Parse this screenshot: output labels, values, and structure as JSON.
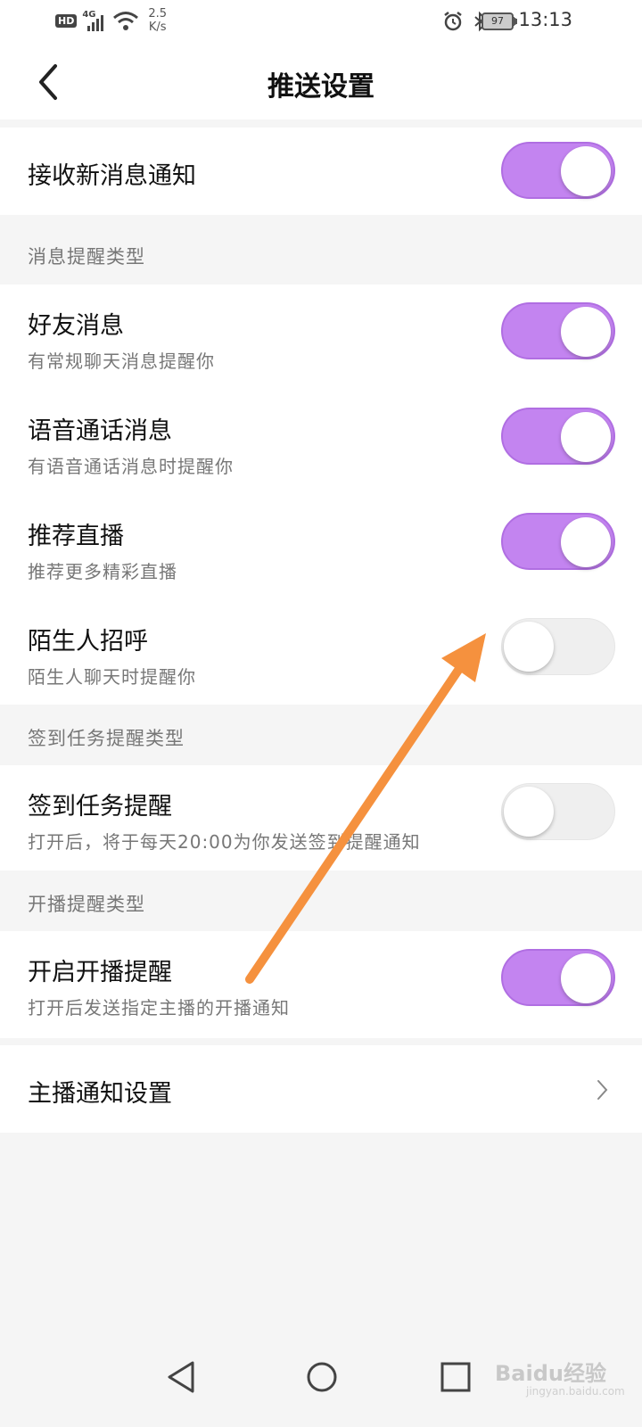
{
  "status_bar": {
    "hd": "HD",
    "network": "4G",
    "speed_value": "2.5",
    "speed_unit": "K/s",
    "battery": "97",
    "time": "13:13",
    "icons": [
      "alarm-icon",
      "bluetooth-icon",
      "vibrate-icon"
    ]
  },
  "header": {
    "back_icon": "chevron-left-icon",
    "title": "推送设置"
  },
  "settings": {
    "receive_new": {
      "title": "接收新消息通知",
      "enabled": true
    },
    "section_message_type": "消息提醒类型",
    "friend": {
      "title": "好友消息",
      "subtitle": "有常规聊天消息提醒你",
      "enabled": true
    },
    "voice": {
      "title": "语音通话消息",
      "subtitle": "有语音通话消息时提醒你",
      "enabled": true
    },
    "recommend": {
      "title": "推荐直播",
      "subtitle": "推荐更多精彩直播",
      "enabled": true
    },
    "stranger": {
      "title": "陌生人招呼",
      "subtitle": "陌生人聊天时提醒你",
      "enabled": false
    },
    "section_checkin_type": "签到任务提醒类型",
    "checkin": {
      "title": "签到任务提醒",
      "subtitle": "打开后，将于每天20:00为你发送签到提醒通知",
      "enabled": false
    },
    "section_live_type": "开播提醒类型",
    "live": {
      "title": "开启开播提醒",
      "subtitle": "打开后发送指定主播的开播通知",
      "enabled": true
    },
    "anchor_settings": {
      "title": "主播通知设置",
      "icon": "chevron-right-icon"
    }
  },
  "colors": {
    "toggle_on": "#c384f0",
    "toggle_off": "#efefef",
    "annotation_arrow": "#f5913e"
  },
  "nav_bar": {
    "icons": [
      "nav-back-icon",
      "nav-home-icon",
      "nav-recents-icon"
    ]
  },
  "watermark": {
    "text": "Baidu经验",
    "sub": "jingyan.baidu.com"
  }
}
